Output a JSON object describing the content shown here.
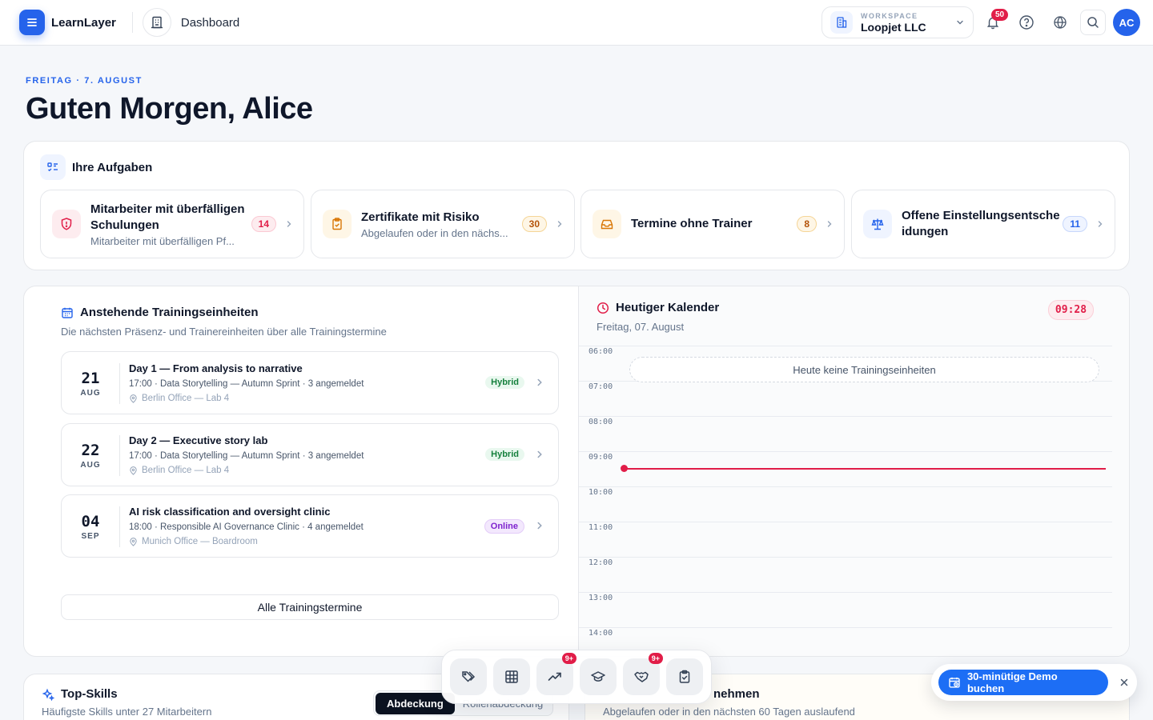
{
  "header": {
    "app_name": "LearnLayer",
    "breadcrumb": "Dashboard",
    "workspace_label": "WORKSPACE",
    "workspace_name": "Loopjet LLC",
    "notification_count": "50",
    "avatar_initials": "AC"
  },
  "greeting": {
    "date": "FREITAG · 7. AUGUST",
    "title": "Guten Morgen, Alice"
  },
  "tasks": {
    "title": "Ihre Aufgaben",
    "items": [
      {
        "title": "Mitarbeiter mit überfälligen Schulungen",
        "subtitle": "Mitarbeiter mit überfälligen Pf...",
        "count": "14",
        "color": "#e11d48",
        "icon": "shield-alert-icon"
      },
      {
        "title": "Zertifikate mit Risiko",
        "subtitle": "Abgelaufen oder in den nächs...",
        "count": "30",
        "color": "#d97706",
        "icon": "clipboard-check-icon"
      },
      {
        "title": "Termine ohne Trainer",
        "subtitle": "",
        "count": "8",
        "color": "#d97706",
        "icon": "inbox-icon"
      },
      {
        "title": "Offene Einstellungsentscheidungen",
        "subtitle": "",
        "count": "11",
        "color": "#2563eb",
        "icon": "scale-icon"
      }
    ]
  },
  "upcoming": {
    "title": "Anstehende Trainingseinheiten",
    "subtitle": "Die nächsten Präsenz- und Trainereinheiten über alle Trainingstermine",
    "events": [
      {
        "day": "21",
        "month": "AUG",
        "title": "Day 1 — From analysis to narrative",
        "meta": "17:00 · Data Storytelling — Autumn Sprint · 3 angemeldet",
        "location": "Berlin Office — Lab 4",
        "tag": "Hybrid"
      },
      {
        "day": "22",
        "month": "AUG",
        "title": "Day 2 — Executive story lab",
        "meta": "17:00 · Data Storytelling — Autumn Sprint · 3 angemeldet",
        "location": "Berlin Office — Lab 4",
        "tag": "Hybrid"
      },
      {
        "day": "04",
        "month": "SEP",
        "title": "AI risk classification and oversight clinic",
        "meta": "18:00 · Responsible AI Governance Clinic · 4 angemeldet",
        "location": "Munich Office — Boardroom",
        "tag": "Online"
      }
    ],
    "all_button": "Alle Trainingstermine"
  },
  "calendar": {
    "title": "Heutiger Kalender",
    "date": "Freitag, 07. August",
    "current_time": "09:28",
    "hours": [
      "06:00",
      "07:00",
      "08:00",
      "09:00",
      "10:00",
      "11:00",
      "12:00",
      "13:00",
      "14:00"
    ],
    "empty_text": "Heute keine Trainingseinheiten"
  },
  "top_skills": {
    "title": "Top-Skills",
    "subtitle": "Häufigste Skills unter 27 Mitarbeitern",
    "toggle_active": "Abdeckung",
    "toggle_inactive": "Rollenabdeckung"
  },
  "expiring": {
    "title_partial": "nehmen",
    "subtitle": "Abgelaufen oder in den nächsten 60 Tagen auslaufend"
  },
  "dock": {
    "items": [
      {
        "icon": "tags-icon",
        "badge": ""
      },
      {
        "icon": "grid-icon",
        "badge": ""
      },
      {
        "icon": "trending-up-icon",
        "badge": "9+"
      },
      {
        "icon": "graduation-cap-icon",
        "badge": ""
      },
      {
        "icon": "handshake-icon",
        "badge": "9+"
      },
      {
        "icon": "clipboard-check-icon",
        "badge": ""
      }
    ]
  },
  "demo": {
    "label": "30-minütige Demo buchen"
  }
}
